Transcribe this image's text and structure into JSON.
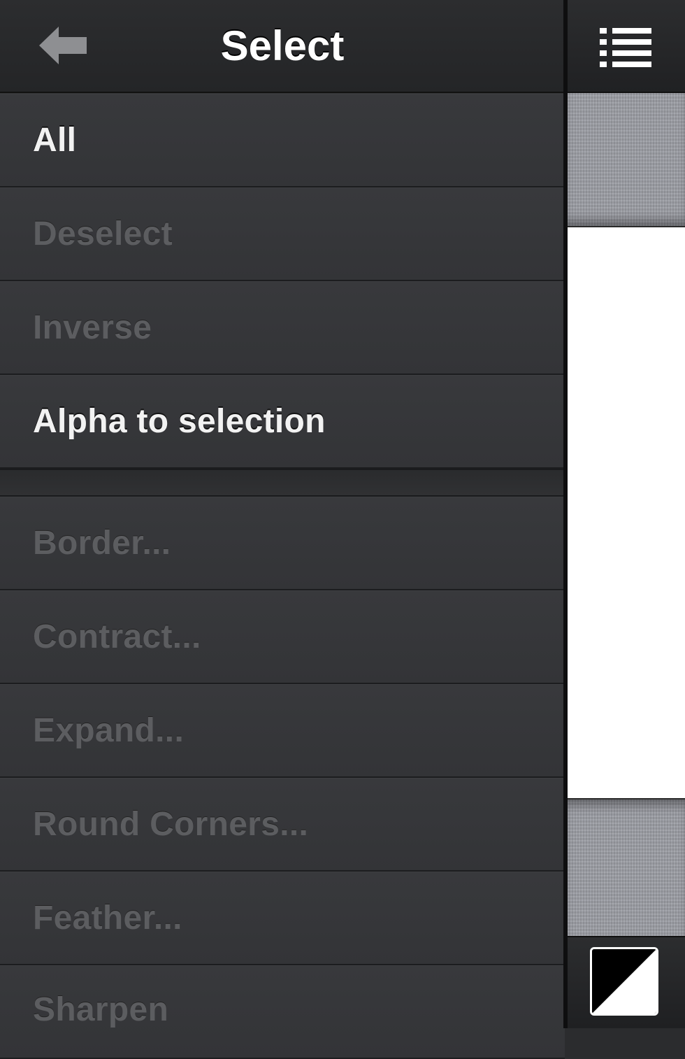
{
  "header": {
    "title": "Select",
    "back_icon": "back-arrow-icon"
  },
  "menu": {
    "items": [
      {
        "label": "All",
        "enabled": true
      },
      {
        "label": "Deselect",
        "enabled": false
      },
      {
        "label": "Inverse",
        "enabled": false
      },
      {
        "label": "Alpha to selection",
        "enabled": true
      },
      {
        "label": "Border...",
        "enabled": false
      },
      {
        "label": "Contract...",
        "enabled": false
      },
      {
        "label": "Expand...",
        "enabled": false
      },
      {
        "label": "Round Corners...",
        "enabled": false
      },
      {
        "label": "Feather...",
        "enabled": false
      },
      {
        "label": "Sharpen",
        "enabled": false
      }
    ]
  },
  "toolbar": {
    "list_icon": "list-menu-icon",
    "color_icon": "foreground-background-color-icon"
  },
  "colors": {
    "panel": "#333436",
    "enabled_text": "#f2f2f2",
    "disabled_text": "#5c5d60",
    "canvas": "#ffffff"
  }
}
